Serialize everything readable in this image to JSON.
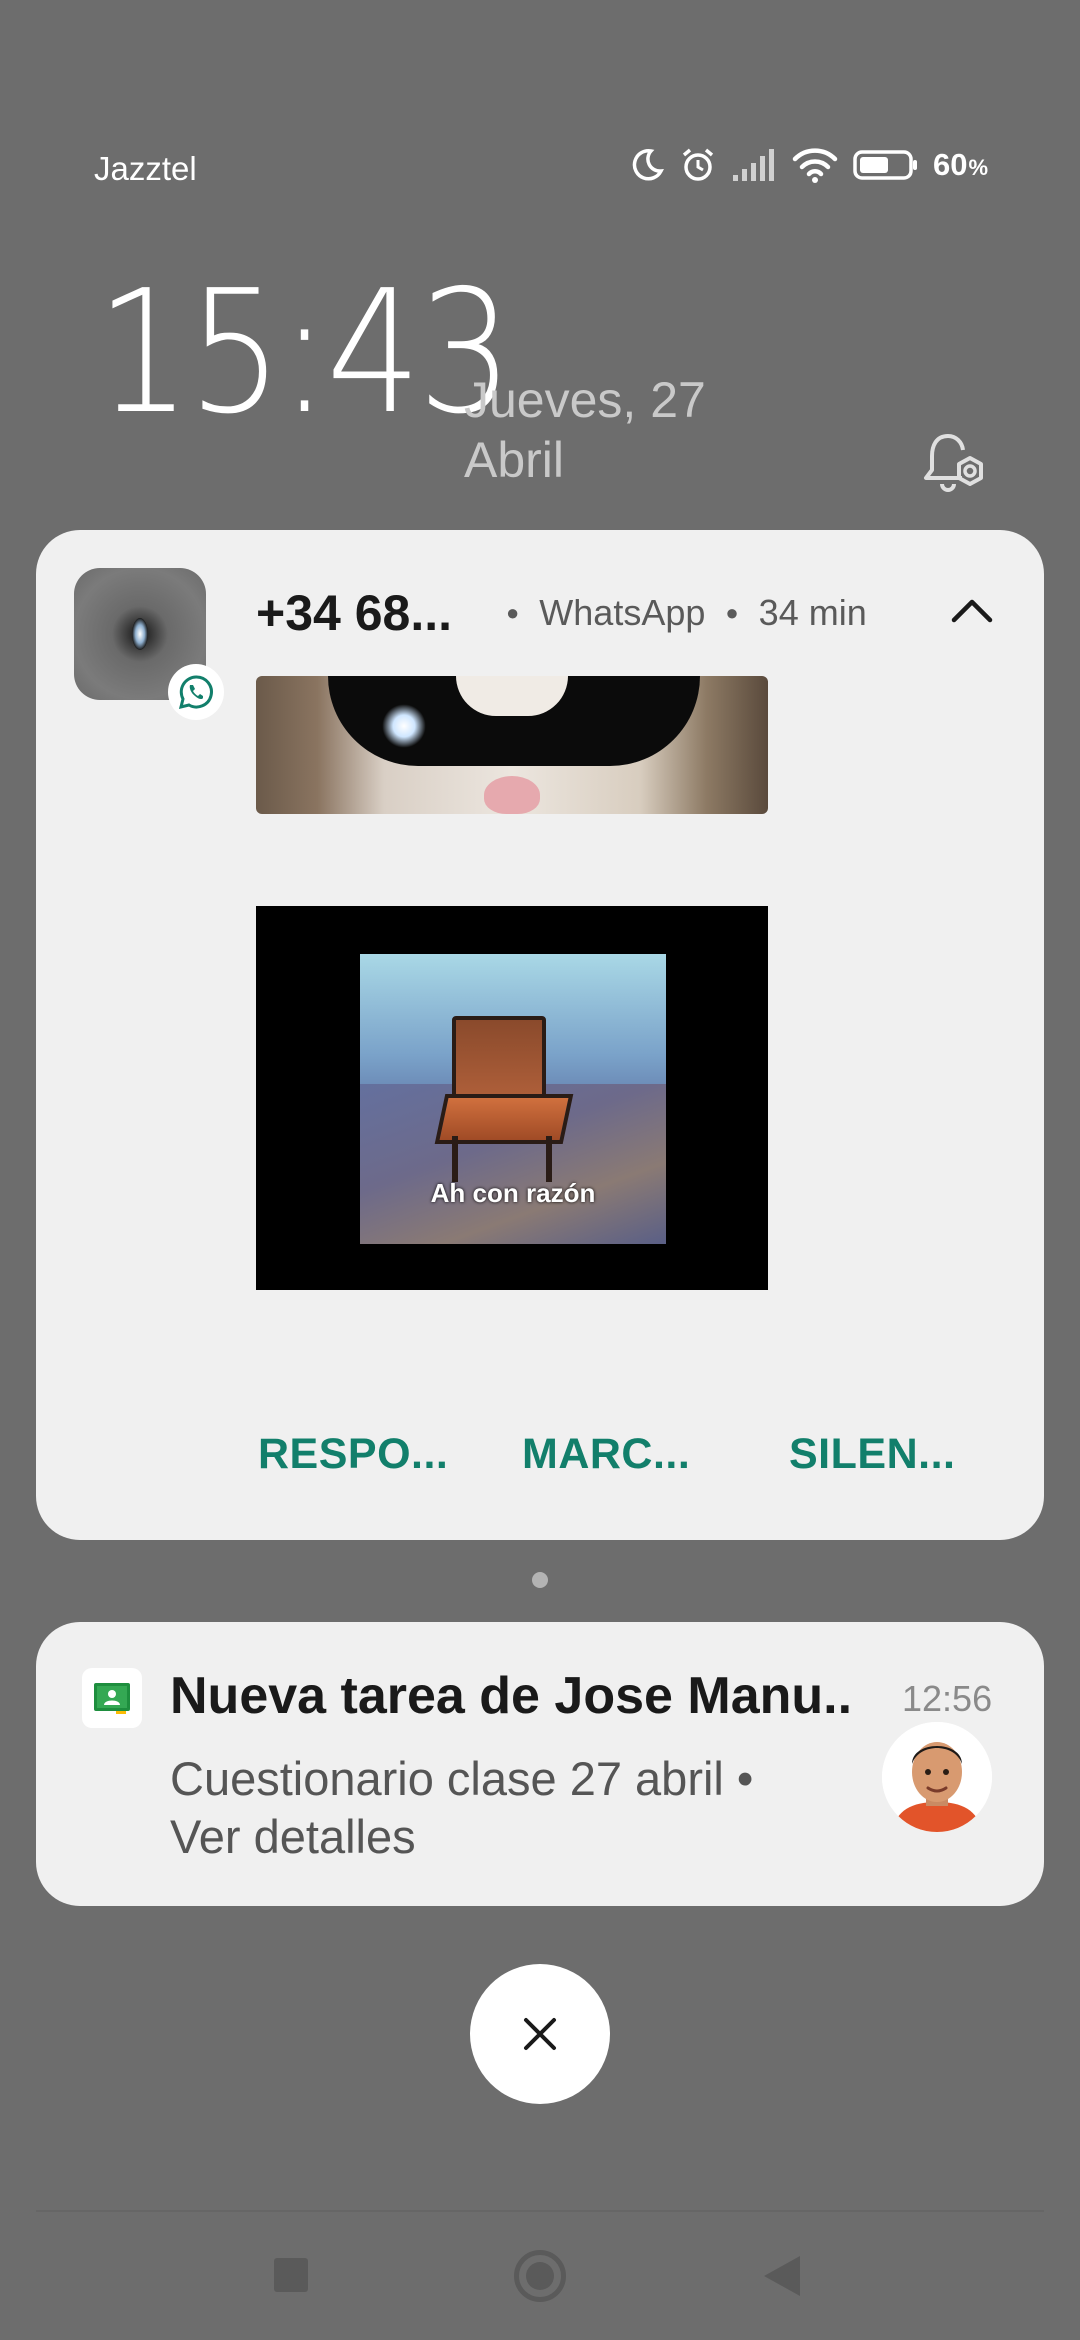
{
  "status_bar": {
    "carrier": "Jazztel",
    "battery_percent": "60",
    "battery_unit": "%",
    "icons": [
      "moon-icon",
      "alarm-icon",
      "signal-icon",
      "wifi-icon",
      "battery-icon"
    ],
    "battery_level": 0.6
  },
  "lockscreen": {
    "time": "15:43",
    "date_line1": "Jueves, 27",
    "date_line2": "Abril"
  },
  "whatsapp_notification": {
    "sender": "+34 68...",
    "app": "WhatsApp",
    "age": "34 min",
    "image_caption": "Ah con razón",
    "actions": [
      "RESPO...",
      "MARC...",
      "SILEN..."
    ],
    "accent_color": "#127f6b"
  },
  "classroom_notification": {
    "title": "Nueva tarea de Jose Manu..",
    "time": "12:56",
    "body": "Cuestionario clase 27 abril • Ver detalles"
  }
}
